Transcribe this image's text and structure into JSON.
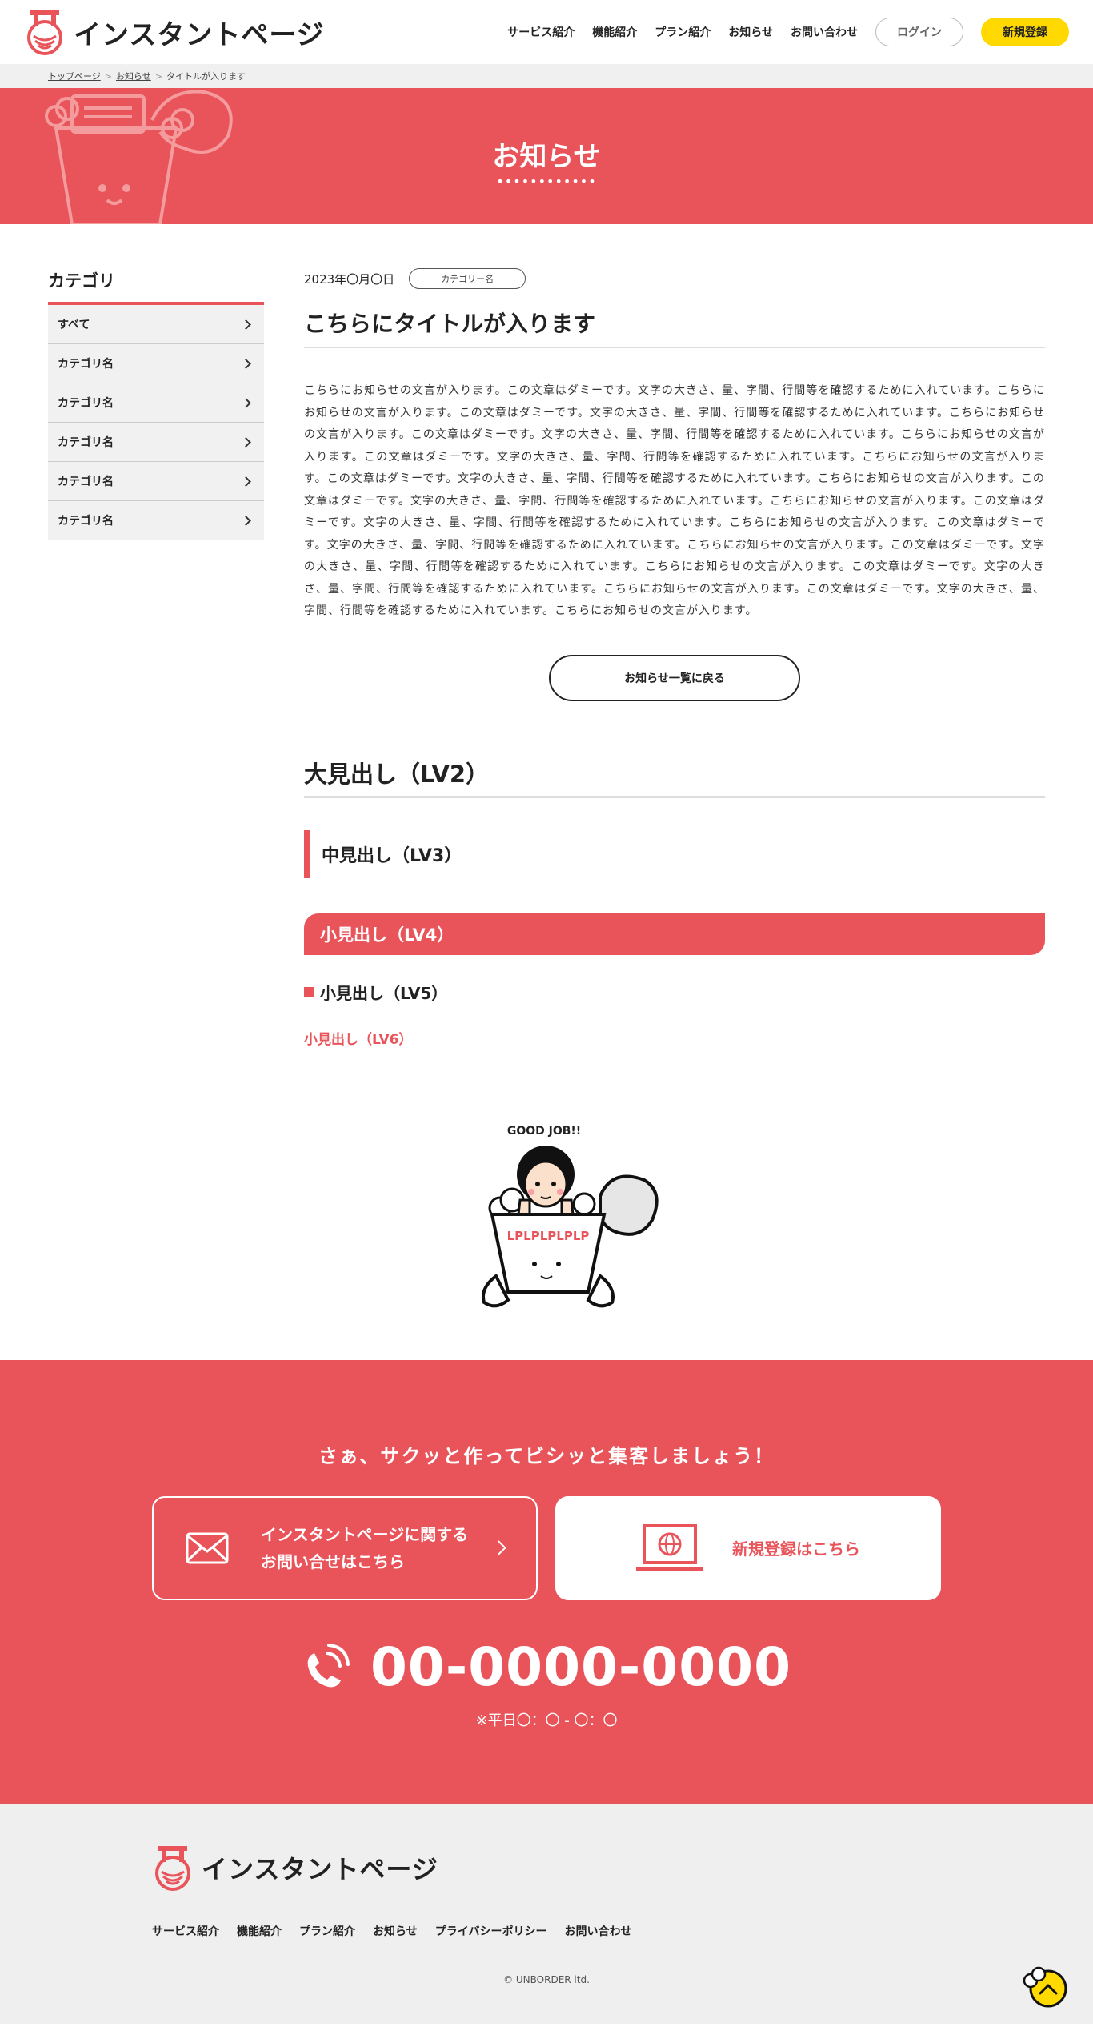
{
  "header": {
    "logo_text": "インスタントページ",
    "nav": [
      "サービス紹介",
      "機能紹介",
      "プラン紹介",
      "お知らせ",
      "お問い合わせ"
    ],
    "login_label": "ログイン",
    "register_label": "新規登録"
  },
  "breadcrumb": {
    "items": [
      "トップページ",
      "お知らせ",
      "タイトルが入ります"
    ]
  },
  "hero": {
    "title": "お知らせ",
    "dots": "••••••••••••"
  },
  "sidebar": {
    "heading": "カテゴリ",
    "items": [
      {
        "label": "すべて"
      },
      {
        "label": "カテゴリ名"
      },
      {
        "label": "カテゴリ名"
      },
      {
        "label": "カテゴリ名"
      },
      {
        "label": "カテゴリ名"
      },
      {
        "label": "カテゴリ名"
      }
    ]
  },
  "post": {
    "date": "2023年〇月〇日",
    "category": "カテゴリー名",
    "title": "こちらにタイトルが入ります",
    "body": "こちらにお知らせの文言が入ります。この文章はダミーです。文字の大きさ、量、字間、行間等を確認するために入れています。こちらにお知らせの文言が入ります。この文章はダミーです。文字の大きさ、量、字間、行間等を確認するために入れています。こちらにお知らせの文言が入ります。この文章はダミーです。文字の大きさ、量、字間、行間等を確認するために入れています。こちらにお知らせの文言が入ります。この文章はダミーです。文字の大きさ、量、字間、行間等を確認するために入れています。こちらにお知らせの文言が入ります。この文章はダミーです。文字の大きさ、量、字間、行間等を確認するために入れています。こちらにお知らせの文言が入ります。この文章はダミーです。文字の大きさ、量、字間、行間等を確認するために入れています。こちらにお知らせの文言が入ります。この文章はダミーです。文字の大きさ、量、字間、行間等を確認するために入れています。こちらにお知らせの文言が入ります。この文章はダミーです。文字の大きさ、量、字間、行間等を確認するために入れています。こちらにお知らせの文言が入ります。この文章はダミーです。文字の大きさ、量、字間、行間等を確認するために入れています。こちらにお知らせの文言が入ります。この文章はダミーです。文字の大きさ、量、字間、行間等を確認するために入れています。こちらにお知らせの文言が入ります。この文章はダミーです。文字の大きさ、量、字間、行間等を確認するために入れています。こちらにお知らせの文言が入ります。",
    "back_label": "お知らせ一覧に戻る"
  },
  "headings": {
    "h2": "大見出し（LV2）",
    "h3": "中見出し（LV3）",
    "h4": "小見出し（LV4）",
    "h5": "小見出し（LV5）",
    "h6": "小見出し（LV6）"
  },
  "mascot": {
    "speech": "GOOD JOB!!",
    "cup_text": "LPLPLPLPLP"
  },
  "cta": {
    "heading": "さぁ、サクッと作ってビシッと集客しましょう！",
    "contact_line1": "インスタントページに関する",
    "contact_line2": "お問い合せはこちら",
    "register_label": "新規登録はこちら",
    "phone": "00-0000-0000",
    "hours": "※平日〇：〇 - 〇：〇"
  },
  "footer": {
    "logo_text": "インスタントページ",
    "nav": [
      "サービス紹介",
      "機能紹介",
      "プラン紹介",
      "お知らせ",
      "プライバシーポリシー",
      "お問い合わせ"
    ],
    "copyright": "© UNBORDER ltd."
  },
  "colors": {
    "accent": "#e9545a",
    "yellow": "#ffd900"
  }
}
